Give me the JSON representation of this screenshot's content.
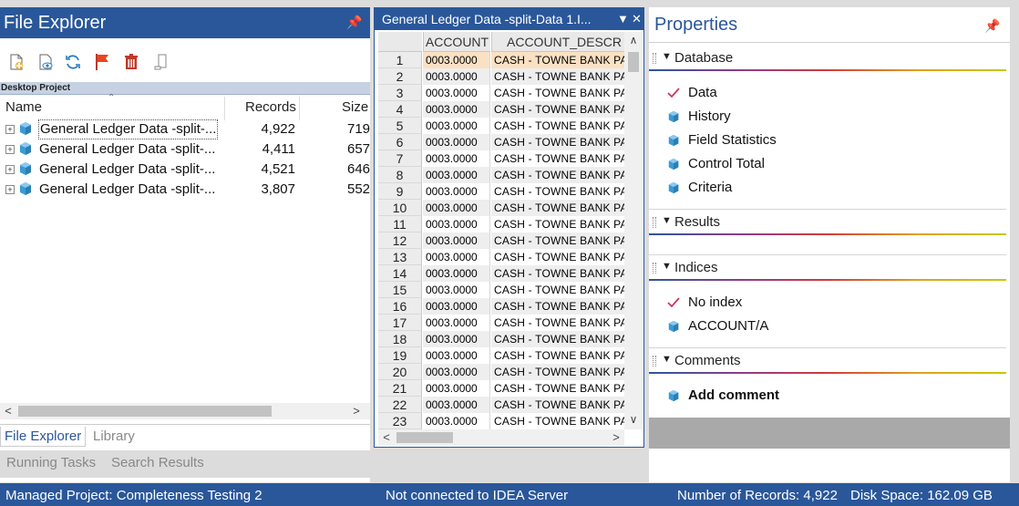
{
  "colors": {
    "accent": "#2a579a",
    "selection": "#fbe1c3",
    "delete": "#c0392b",
    "flag": "#e8461e",
    "cube": "#3a9bd5",
    "check": "#c8385a"
  },
  "file_explorer": {
    "title": "File Explorer",
    "pin_glyph": "📌",
    "toolbar_icons": [
      "new-file-icon",
      "preview-icon",
      "refresh-icon",
      "flag-icon",
      "delete-icon",
      "device-icon"
    ],
    "project_label": "Desktop Project",
    "columns": {
      "name": "Name",
      "records": "Records",
      "size": "Size"
    },
    "rows": [
      {
        "name": "General Ledger Data -split-...",
        "records": "4,922",
        "size": "719"
      },
      {
        "name": "General Ledger Data -split-...",
        "records": "4,411",
        "size": "657"
      },
      {
        "name": "General Ledger Data -split-...",
        "records": "4,521",
        "size": "646"
      },
      {
        "name": "General Ledger Data -split-...",
        "records": "3,807",
        "size": "552"
      }
    ],
    "scroll_left": "<",
    "scroll_right": ">",
    "tabs": [
      "File Explorer",
      "Library"
    ]
  },
  "task_tabs": [
    "Running Tasks",
    "Search Results"
  ],
  "grid_view": {
    "tab_title": "General Ledger Data -split-Data 1.I...",
    "tab_menu_glyph": "▼",
    "tab_close_glyph": "✕",
    "columns": [
      "ACCOUNT",
      "ACCOUNT_DESCR"
    ],
    "rows": [
      {
        "n": "1",
        "account": "0003.0000",
        "desc": "CASH - TOWNE BANK PAY"
      },
      {
        "n": "2",
        "account": "0003.0000",
        "desc": "CASH - TOWNE BANK PAY"
      },
      {
        "n": "3",
        "account": "0003.0000",
        "desc": "CASH - TOWNE BANK PAY"
      },
      {
        "n": "4",
        "account": "0003.0000",
        "desc": "CASH - TOWNE BANK PAY"
      },
      {
        "n": "5",
        "account": "0003.0000",
        "desc": "CASH - TOWNE BANK PAY"
      },
      {
        "n": "6",
        "account": "0003.0000",
        "desc": "CASH - TOWNE BANK PAY"
      },
      {
        "n": "7",
        "account": "0003.0000",
        "desc": "CASH - TOWNE BANK PAY"
      },
      {
        "n": "8",
        "account": "0003.0000",
        "desc": "CASH - TOWNE BANK PAY"
      },
      {
        "n": "9",
        "account": "0003.0000",
        "desc": "CASH - TOWNE BANK PAY"
      },
      {
        "n": "10",
        "account": "0003.0000",
        "desc": "CASH - TOWNE BANK PAY"
      },
      {
        "n": "11",
        "account": "0003.0000",
        "desc": "CASH - TOWNE BANK PAY"
      },
      {
        "n": "12",
        "account": "0003.0000",
        "desc": "CASH - TOWNE BANK PAY"
      },
      {
        "n": "13",
        "account": "0003.0000",
        "desc": "CASH - TOWNE BANK PAY"
      },
      {
        "n": "14",
        "account": "0003.0000",
        "desc": "CASH - TOWNE BANK PAY"
      },
      {
        "n": "15",
        "account": "0003.0000",
        "desc": "CASH - TOWNE BANK PAY"
      },
      {
        "n": "16",
        "account": "0003.0000",
        "desc": "CASH - TOWNE BANK PAY"
      },
      {
        "n": "17",
        "account": "0003.0000",
        "desc": "CASH - TOWNE BANK PAY"
      },
      {
        "n": "18",
        "account": "0003.0000",
        "desc": "CASH - TOWNE BANK PAY"
      },
      {
        "n": "19",
        "account": "0003.0000",
        "desc": "CASH - TOWNE BANK PAY"
      },
      {
        "n": "20",
        "account": "0003.0000",
        "desc": "CASH - TOWNE BANK PAY"
      },
      {
        "n": "21",
        "account": "0003.0000",
        "desc": "CASH - TOWNE BANK PAY"
      },
      {
        "n": "22",
        "account": "0003.0000",
        "desc": "CASH - TOWNE BANK PAY"
      },
      {
        "n": "23",
        "account": "0003.0000",
        "desc": "CASH - TOWNE BANK PAY"
      }
    ],
    "scroll_up": "∧",
    "scroll_down": "∨",
    "scroll_left": "<",
    "scroll_right": ">"
  },
  "properties": {
    "title": "Properties",
    "pin_glyph": "📌",
    "sections": [
      {
        "label": "Database",
        "items": [
          {
            "icon": "checkmark-icon",
            "label": "Data"
          },
          {
            "icon": "cube-icon",
            "label": "History"
          },
          {
            "icon": "cube-icon",
            "label": "Field Statistics"
          },
          {
            "icon": "cube-icon",
            "label": "Control Total"
          },
          {
            "icon": "cube-icon",
            "label": "Criteria"
          }
        ]
      },
      {
        "label": "Results",
        "items": []
      },
      {
        "label": "Indices",
        "items": [
          {
            "icon": "checkmark-icon",
            "label": "No index"
          },
          {
            "icon": "cube-icon",
            "label": "ACCOUNT/A"
          }
        ]
      },
      {
        "label": "Comments",
        "items": [
          {
            "icon": "cube-icon",
            "label": "Add comment"
          }
        ]
      }
    ]
  },
  "status_bar": {
    "project": "Managed Project: Completeness Testing 2",
    "server": "Not connected to IDEA Server",
    "records": "Number of Records: 4,922",
    "disk": "Disk Space: 162.09 GB"
  }
}
